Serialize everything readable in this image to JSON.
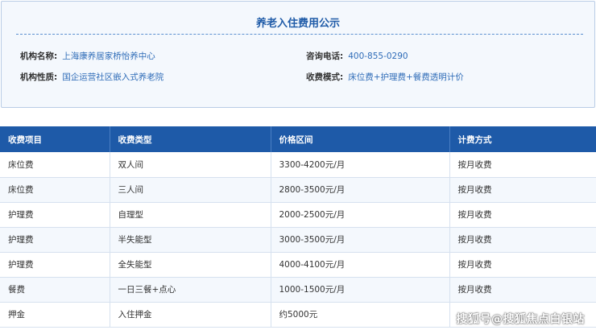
{
  "info": {
    "title": "养老入住费用公示",
    "fields": [
      {
        "label": "机构名称:",
        "value": "上海康养居家桥怡养中心"
      },
      {
        "label": "机构性质:",
        "value": "国企运营社区嵌入式养老院"
      },
      {
        "label": "咨询电话:",
        "value": "400-855-0290"
      },
      {
        "label": "收费模式:",
        "value": "床位费+护理费+餐费透明计价"
      }
    ]
  },
  "table": {
    "headers": [
      "收费项目",
      "收费类型",
      "价格区间",
      "计费方式"
    ],
    "rows": [
      [
        "床位费",
        "双人间",
        "3300-4200元/月",
        "按月收费"
      ],
      [
        "床位费",
        "三人间",
        "2800-3500元/月",
        "按月收费"
      ],
      [
        "护理费",
        "自理型",
        "2000-2500元/月",
        "按月收费"
      ],
      [
        "护理费",
        "半失能型",
        "3000-3500元/月",
        "按月收费"
      ],
      [
        "护理费",
        "全失能型",
        "4000-4100元/月",
        "按月收费"
      ],
      [
        "餐费",
        "一日三餐+点心",
        "1000-1500元/月",
        "按月收费"
      ],
      [
        "押金",
        "入住押金",
        "约5000元",
        ""
      ]
    ]
  },
  "watermark": "搜狐号@搜狐焦点白银站",
  "colors": {
    "header_bg": "#1e5aa8",
    "title": "#1f5ba8",
    "value_text": "#2f6cb8",
    "card_bg": "#f4f8fd"
  }
}
